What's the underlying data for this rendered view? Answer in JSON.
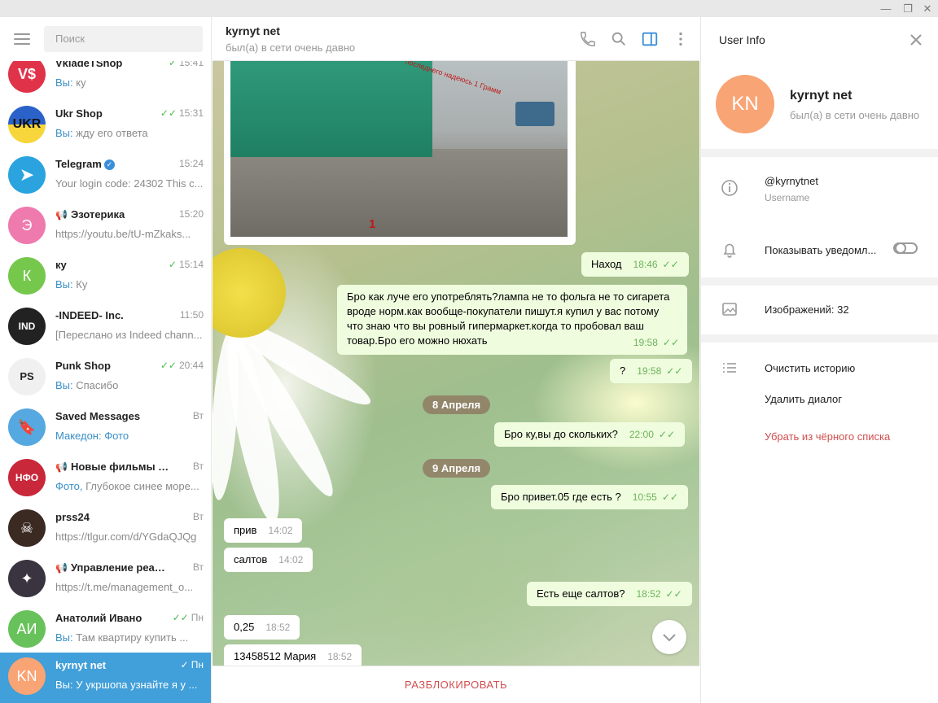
{
  "window": {
    "controls": [
      "—",
      "❐",
      "✕"
    ]
  },
  "search": {
    "placeholder": "Поиск"
  },
  "chats": [
    {
      "name": "VkladeTShop",
      "time": "15:41",
      "checks": "✓",
      "you": "Вы: ",
      "preview": "ку",
      "avatar_text": "V$",
      "avatar_color": "#e0334a"
    },
    {
      "name": "Ukr Shop",
      "time": "15:31",
      "checks": "✓✓",
      "you": "Вы: ",
      "preview": "жду его ответа",
      "avatar_text": "UKR",
      "avatar_color": "#f6d63a"
    },
    {
      "name": "Telegram",
      "time": "15:24",
      "checks": "",
      "you": "",
      "preview": "Your login code: 24302  This c...",
      "avatar_text": "➤",
      "avatar_color": "#2aa3df",
      "verified": "✓"
    },
    {
      "name": "Эзотерика",
      "time": "15:20",
      "checks": "",
      "you": "",
      "preview": "https://youtu.be/tU-mZkaks...",
      "avatar_text": "Э",
      "avatar_color": "#ee7aae",
      "channel": "📢"
    },
    {
      "name": "ку",
      "time": "15:14",
      "checks": "✓",
      "you": "Вы: ",
      "preview": "Ку",
      "avatar_text": "К",
      "avatar_color": "#76c84d"
    },
    {
      "name": "-INDEED- Inc.",
      "time": "11:50",
      "checks": "",
      "you": "",
      "preview": "[Переслано из Indeed chann...",
      "avatar_text": "IND",
      "avatar_color": "#222222"
    },
    {
      "name": "Punk Shop",
      "time": "20:44",
      "checks": "✓✓",
      "you": "Вы: ",
      "preview": "Спасибо",
      "avatar_text": "PS",
      "avatar_color": "#f0f0f0"
    },
    {
      "name": "Saved Messages",
      "time": "Вт",
      "checks": "",
      "you": "Македон: ",
      "preview": "Фото",
      "avatar_text": "🔖",
      "avatar_color": "#56a8e0"
    },
    {
      "name": "Новые фильмы он...",
      "time": "Вт",
      "checks": "",
      "you": "Фото, ",
      "preview": "Глубокое синее море...",
      "avatar_text": "НФО",
      "avatar_color": "#c9283a",
      "channel": "📢"
    },
    {
      "name": "prss24",
      "time": "Вт",
      "checks": "",
      "you": "",
      "preview": "https://tlgur.com/d/YGdaQJQg",
      "avatar_text": "☠",
      "avatar_color": "#3a2a22"
    },
    {
      "name": "Управление реальн...",
      "time": "Вт",
      "checks": "",
      "you": "",
      "preview": "https://t.me/management_o...",
      "avatar_text": "✦",
      "avatar_color": "#3a3440",
      "channel": "📢"
    },
    {
      "name": "Анатолий Ивано",
      "time": "Пн",
      "checks": "✓✓",
      "you": "Вы: ",
      "preview": "Там квартиру купить ...",
      "avatar_text": "АИ",
      "avatar_color": "#68c25b"
    },
    {
      "name": "kyrnyt net",
      "time": "Пн",
      "checks": "✓",
      "you": "Вы: ",
      "preview": "У укршопа узнайте я у ...",
      "avatar_text": "KN",
      "avatar_color": "#f8a475",
      "active": true
    }
  ],
  "header": {
    "name": "kyrnyt net",
    "status": "был(а) в сети очень давно"
  },
  "photo": {
    "caption_red": "1",
    "overlay_text": "последнего надеюсь 1 Грамм"
  },
  "messages": {
    "m1": {
      "text": "Наход",
      "time": "18:46",
      "ticks": "✓✓"
    },
    "m2": {
      "text": "Бро как луче его употреблять?лампа не то фольга не то сигарета вроде норм.как вообще-покупатели пишут.я купил у вас потому что знаю что вы ровный гипермаркет.когда то пробовал ваш товар.Бро его можно нюхать",
      "time": "19:58",
      "ticks": "✓✓"
    },
    "m3": {
      "text": "?",
      "time": "19:58",
      "ticks": "✓✓"
    },
    "d1": "8 Апреля",
    "m4": {
      "text": "Бро ку,вы до скольких?",
      "time": "22:00",
      "ticks": "✓✓"
    },
    "d2": "9 Апреля",
    "m5": {
      "text": "Бро привет.05 где есть ?",
      "time": "10:55",
      "ticks": "✓✓"
    },
    "m6": {
      "text": "прив",
      "time": "14:02"
    },
    "m7": {
      "text": "салтов",
      "time": "14:02"
    },
    "m8": {
      "text": "Есть еще салтов?",
      "time": "18:52",
      "ticks": "✓✓"
    },
    "m9": {
      "text": "0,25",
      "time": "18:52"
    },
    "m10": {
      "text": "13458512  Мария",
      "time": "18:52"
    }
  },
  "unblock": "РАЗБЛОКИРОВАТЬ",
  "info": {
    "title": "User Info",
    "avatar_text": "KN",
    "name": "kyrnyt net",
    "status": "был(а) в сети очень давно",
    "username": "@kyrnytnet",
    "username_label": "Username",
    "notifications": "Показывать уведомл...",
    "notifications_on": false,
    "images": "Изображений: 32",
    "clear_history": "Очистить историю",
    "delete_dialog": "Удалить диалог",
    "unblacklist": "Убрать из чёрного списка"
  },
  "colors": {
    "accent": "#419fd9",
    "outgoing": "#effdde",
    "danger": "#d14e4e",
    "avatar_kn": "#f8a475"
  }
}
